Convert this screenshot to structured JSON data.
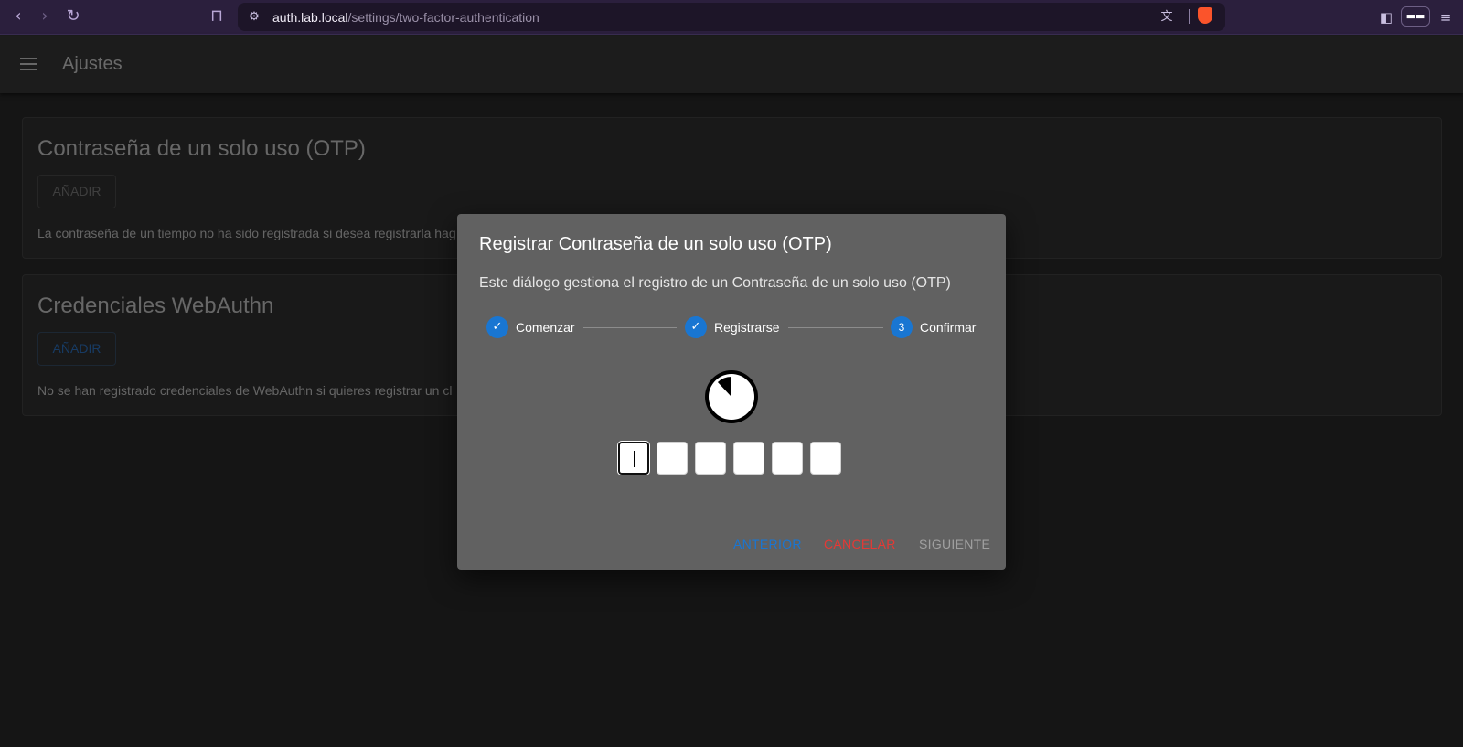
{
  "browser": {
    "url_host": "auth.lab.local",
    "url_path": "/settings/two-factor-authentication",
    "back_icon": "back-arrow-icon",
    "forward_icon": "forward-arrow-icon",
    "reload_icon": "reload-icon",
    "bookmark_icon": "bookmark-icon"
  },
  "appbar": {
    "title": "Ajustes"
  },
  "cards": {
    "otp": {
      "title": "Contraseña de un solo uso (OTP)",
      "button": "AÑADIR",
      "text": "La contraseña de un tiempo no ha sido registrada si desea registrarla hag"
    },
    "webauthn": {
      "title": "Credenciales WebAuthn",
      "button": "AÑADIR",
      "text": "No se han registrado credenciales de WebAuthn si quieres registrar un cl"
    }
  },
  "dialog": {
    "title": "Registrar Contraseña de un solo uso (OTP)",
    "subtitle": "Este diálogo gestiona el registro de un Contraseña de un solo uso (OTP)",
    "steps": [
      {
        "label": "Comenzar",
        "state": "complete"
      },
      {
        "label": "Registrarse",
        "state": "complete"
      },
      {
        "label": "Confirmar",
        "state": "active",
        "number": "3"
      }
    ],
    "otp_length": 6,
    "timer_progress": 0.12,
    "actions": {
      "previous": "ANTERIOR",
      "cancel": "CANCELAR",
      "next": "SIGUIENTE"
    }
  },
  "colors": {
    "accent": "#1976d2",
    "cancel": "#e53935"
  }
}
